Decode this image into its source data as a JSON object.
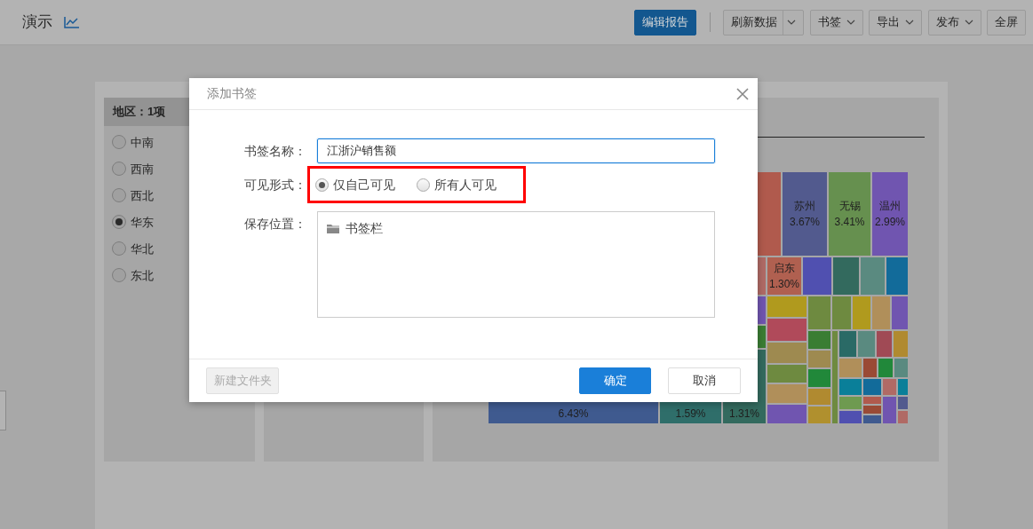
{
  "toolbar": {
    "title": "演示",
    "buttons": [
      {
        "label": "编辑报告",
        "kind": "primary"
      },
      {
        "label": "刷新数据",
        "kind": "split"
      },
      {
        "label": "书签",
        "kind": "dropdown"
      },
      {
        "label": "导出",
        "kind": "dropdown"
      },
      {
        "label": "发布",
        "kind": "dropdown"
      },
      {
        "label": "全屏",
        "kind": "plain"
      }
    ]
  },
  "filter": {
    "title": "地区：1项",
    "options": [
      {
        "label": "中南",
        "selected": false
      },
      {
        "label": "西南",
        "selected": false
      },
      {
        "label": "西北",
        "selected": false
      },
      {
        "label": "华东",
        "selected": true
      },
      {
        "label": "华北",
        "selected": false
      },
      {
        "label": "东北",
        "selected": false
      }
    ]
  },
  "treemap": {
    "cells": [
      {
        "label": "苏州",
        "percent": "3.67%",
        "color": "#525a8e"
      },
      {
        "label": "无锡",
        "percent": "3.41%",
        "color": "#66904f"
      },
      {
        "label": "温州",
        "percent": "2.99%",
        "color": "#7055b0"
      },
      {
        "label": "启东",
        "percent": "1.30%",
        "color": "#b06050"
      },
      {
        "percent": "6.43%",
        "color": "#3f5a8f"
      },
      {
        "percent": "1.59%",
        "color": "#2f6e6a"
      },
      {
        "percent": "1.31%",
        "color": "#336a5e"
      }
    ]
  },
  "dialog": {
    "title": "添加书签",
    "fields": [
      {
        "kind": "text",
        "label": "书签名称：",
        "value": "江浙沪销售额"
      },
      {
        "kind": "radio",
        "label": "可见形式：",
        "highlighted": true,
        "options": [
          {
            "label": "仅自己可见",
            "selected": true
          },
          {
            "label": "所有人可见",
            "selected": false
          }
        ]
      },
      {
        "kind": "tree",
        "label": "保存位置：",
        "items": [
          {
            "label": "书签栏"
          }
        ]
      }
    ],
    "new_folder": {
      "label": "新建文件夹",
      "disabled": true
    },
    "confirm": "确定",
    "cancel": "取消"
  }
}
